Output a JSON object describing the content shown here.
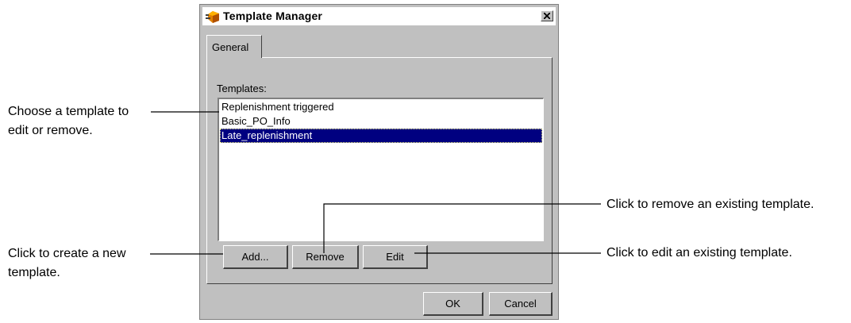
{
  "dialog": {
    "title": "Template Manager",
    "tab_label": "General",
    "templates_label": "Templates:",
    "templates": [
      "Replenishment triggered",
      "Basic_PO_Info",
      "Late_replenishment"
    ],
    "selected_template": "Late_replenishment",
    "buttons": {
      "add": "Add...",
      "remove": "Remove",
      "edit": "Edit",
      "ok": "OK",
      "cancel": "Cancel"
    },
    "icons": {
      "app": "template-manager-icon",
      "close": "close-icon"
    },
    "colors": {
      "window_bg": "#c0c0c0",
      "selection_bg": "#000080",
      "selection_text": "#ffffff"
    }
  },
  "annotations": {
    "choose_line1": "Choose a template to",
    "choose_line2": "edit or remove.",
    "create_line1": "Click to create a new",
    "create_line2": "template.",
    "remove": "Click to remove an existing template.",
    "edit": "Click to edit an existing template."
  }
}
